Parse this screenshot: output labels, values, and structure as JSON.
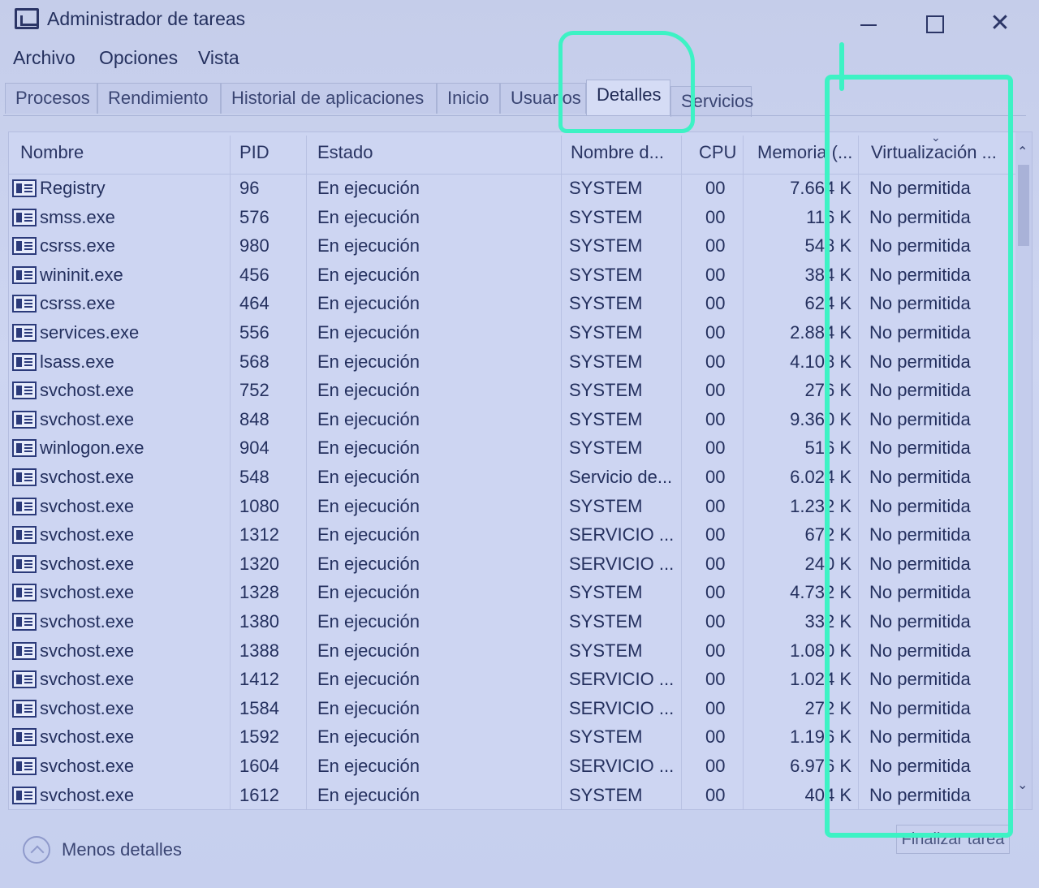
{
  "window": {
    "title": "Administrador de tareas"
  },
  "menu": [
    "Archivo",
    "Opciones",
    "Vista"
  ],
  "tabs": [
    "Procesos",
    "Rendimiento",
    "Historial de aplicaciones",
    "Inicio",
    "Usuarios",
    "Detalles",
    "Servicios"
  ],
  "active_tab": "Detalles",
  "table": {
    "columns": [
      "Nombre",
      "PID",
      "Estado",
      "Nombre d...",
      "CPU",
      "Memoria (...",
      "Virtualización ..."
    ],
    "rows": [
      {
        "name": "Registry",
        "pid": "96",
        "state": "En ejecución",
        "user": "SYSTEM",
        "cpu": "00",
        "mem": "7.664 K",
        "virt": "No permitida"
      },
      {
        "name": "smss.exe",
        "pid": "576",
        "state": "En ejecución",
        "user": "SYSTEM",
        "cpu": "00",
        "mem": "116 K",
        "virt": "No permitida"
      },
      {
        "name": "csrss.exe",
        "pid": "980",
        "state": "En ejecución",
        "user": "SYSTEM",
        "cpu": "00",
        "mem": "548 K",
        "virt": "No permitida"
      },
      {
        "name": "wininit.exe",
        "pid": "456",
        "state": "En ejecución",
        "user": "SYSTEM",
        "cpu": "00",
        "mem": "384 K",
        "virt": "No permitida"
      },
      {
        "name": "csrss.exe",
        "pid": "464",
        "state": "En ejecución",
        "user": "SYSTEM",
        "cpu": "00",
        "mem": "624 K",
        "virt": "No permitida"
      },
      {
        "name": "services.exe",
        "pid": "556",
        "state": "En ejecución",
        "user": "SYSTEM",
        "cpu": "00",
        "mem": "2.884 K",
        "virt": "No permitida"
      },
      {
        "name": "lsass.exe",
        "pid": "568",
        "state": "En ejecución",
        "user": "SYSTEM",
        "cpu": "00",
        "mem": "4.108 K",
        "virt": "No permitida"
      },
      {
        "name": "svchost.exe",
        "pid": "752",
        "state": "En ejecución",
        "user": "SYSTEM",
        "cpu": "00",
        "mem": "276 K",
        "virt": "No permitida"
      },
      {
        "name": "svchost.exe",
        "pid": "848",
        "state": "En ejecución",
        "user": "SYSTEM",
        "cpu": "00",
        "mem": "9.360 K",
        "virt": "No permitida"
      },
      {
        "name": "winlogon.exe",
        "pid": "904",
        "state": "En ejecución",
        "user": "SYSTEM",
        "cpu": "00",
        "mem": "516 K",
        "virt": "No permitida"
      },
      {
        "name": "svchost.exe",
        "pid": "548",
        "state": "En ejecución",
        "user": "Servicio de...",
        "cpu": "00",
        "mem": "6.024 K",
        "virt": "No permitida"
      },
      {
        "name": "svchost.exe",
        "pid": "1080",
        "state": "En ejecución",
        "user": "SYSTEM",
        "cpu": "00",
        "mem": "1.232 K",
        "virt": "No permitida"
      },
      {
        "name": "svchost.exe",
        "pid": "1312",
        "state": "En ejecución",
        "user": "SERVICIO ...",
        "cpu": "00",
        "mem": "672 K",
        "virt": "No permitida"
      },
      {
        "name": "svchost.exe",
        "pid": "1320",
        "state": "En ejecución",
        "user": "SERVICIO ...",
        "cpu": "00",
        "mem": "240 K",
        "virt": "No permitida"
      },
      {
        "name": "svchost.exe",
        "pid": "1328",
        "state": "En ejecución",
        "user": "SYSTEM",
        "cpu": "00",
        "mem": "4.732 K",
        "virt": "No permitida"
      },
      {
        "name": "svchost.exe",
        "pid": "1380",
        "state": "En ejecución",
        "user": "SYSTEM",
        "cpu": "00",
        "mem": "332 K",
        "virt": "No permitida"
      },
      {
        "name": "svchost.exe",
        "pid": "1388",
        "state": "En ejecución",
        "user": "SYSTEM",
        "cpu": "00",
        "mem": "1.080 K",
        "virt": "No permitida"
      },
      {
        "name": "svchost.exe",
        "pid": "1412",
        "state": "En ejecución",
        "user": "SERVICIO ...",
        "cpu": "00",
        "mem": "1.024 K",
        "virt": "No permitida"
      },
      {
        "name": "svchost.exe",
        "pid": "1584",
        "state": "En ejecución",
        "user": "SERVICIO ...",
        "cpu": "00",
        "mem": "272 K",
        "virt": "No permitida"
      },
      {
        "name": "svchost.exe",
        "pid": "1592",
        "state": "En ejecución",
        "user": "SYSTEM",
        "cpu": "00",
        "mem": "1.196 K",
        "virt": "No permitida"
      },
      {
        "name": "svchost.exe",
        "pid": "1604",
        "state": "En ejecución",
        "user": "SERVICIO ...",
        "cpu": "00",
        "mem": "6.976 K",
        "virt": "No permitida"
      },
      {
        "name": "svchost.exe",
        "pid": "1612",
        "state": "En ejecución",
        "user": "SYSTEM",
        "cpu": "00",
        "mem": "404 K",
        "virt": "No permitida"
      }
    ]
  },
  "footer": {
    "fewer_details": "Menos detalles",
    "end_task": "Finalizar tarea"
  },
  "colors": {
    "annotation": "#3df2c4",
    "background": "#c9d3ef",
    "text": "#24305e"
  }
}
